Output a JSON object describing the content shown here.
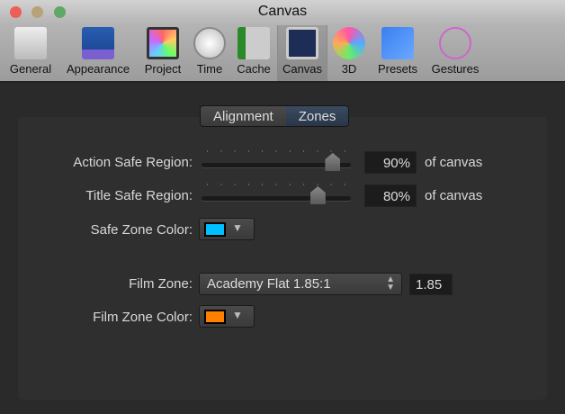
{
  "window": {
    "title": "Canvas"
  },
  "toolbar": {
    "items": [
      {
        "label": "General"
      },
      {
        "label": "Appearance"
      },
      {
        "label": "Project"
      },
      {
        "label": "Time"
      },
      {
        "label": "Cache"
      },
      {
        "label": "Canvas",
        "selected": true
      },
      {
        "label": "3D"
      },
      {
        "label": "Presets"
      },
      {
        "label": "Gestures"
      }
    ]
  },
  "tabs": [
    {
      "label": "Alignment"
    },
    {
      "label": "Zones",
      "selected": true
    }
  ],
  "action_safe": {
    "label": "Action Safe Region:",
    "value": "90%",
    "percent": 90,
    "unit": "of canvas"
  },
  "title_safe": {
    "label": "Title Safe Region:",
    "value": "80%",
    "percent": 80,
    "unit": "of canvas"
  },
  "safe_zone_color": {
    "label": "Safe Zone Color:",
    "color": "#00bfff"
  },
  "film_zone": {
    "label": "Film Zone:",
    "value": "Academy Flat 1.85:1",
    "ratio": "1.85"
  },
  "film_zone_color": {
    "label": "Film Zone Color:",
    "color": "#ff8000"
  }
}
